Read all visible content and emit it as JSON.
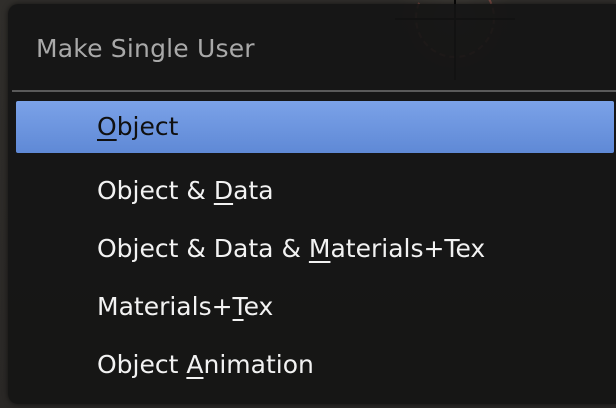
{
  "menu": {
    "title": "Make Single User",
    "items": [
      {
        "label": "Object",
        "mnemonic_index": 0,
        "active": true
      },
      {
        "label": "Object & Data",
        "mnemonic_index": 9,
        "active": false
      },
      {
        "label": "Object & Data & Materials+Tex",
        "mnemonic_index": 16,
        "active": false
      },
      {
        "label": "Materials+Tex",
        "mnemonic_index": 10,
        "active": false
      },
      {
        "label": "Object Animation",
        "mnemonic_index": 7,
        "active": false
      }
    ]
  },
  "colors": {
    "menu_background": "#141414",
    "highlight": "#6f96e0",
    "title_text": "#a9a9a9",
    "item_text": "#f2f2f2"
  },
  "icons": {
    "viewport_cursor": "3d-cursor-icon"
  }
}
